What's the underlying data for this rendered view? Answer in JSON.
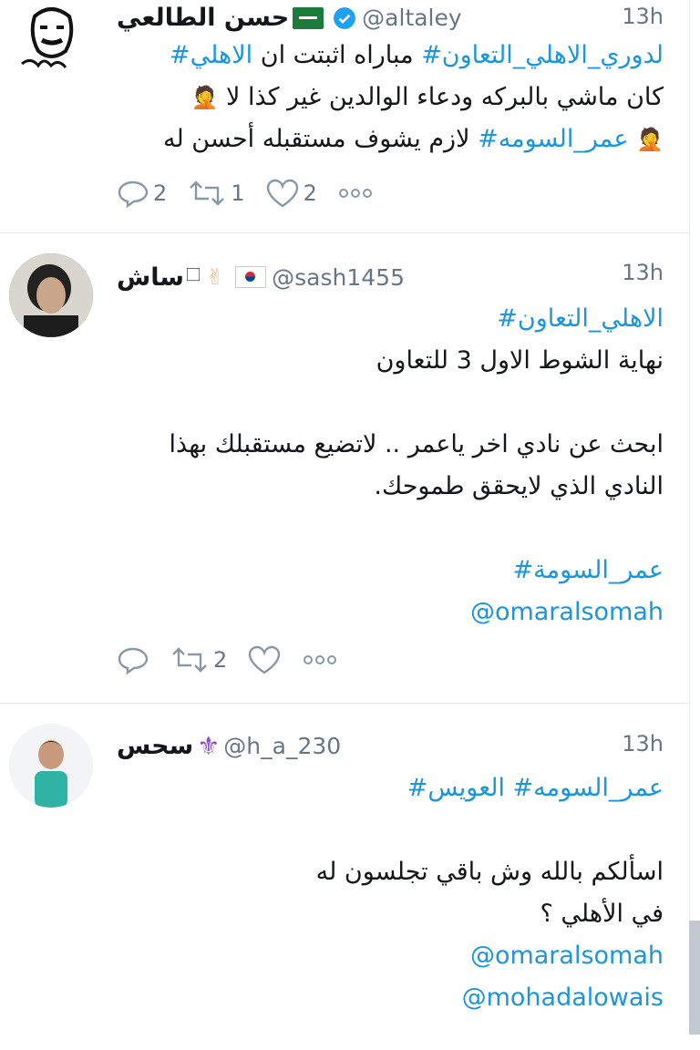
{
  "colors": {
    "link": "#1b95e0",
    "muted": "#657786",
    "text": "#14171a",
    "verified": "#1da1f2"
  },
  "tweets": [
    {
      "name": "حسن الطالعي",
      "handle": "@altaley",
      "time": "13h",
      "verified": true,
      "flag": "saudi-flag",
      "lines": [
        {
          "tag1": "لدوري_الاهلي_التعاون#",
          "text": " مباراه اثبتت ان ",
          "tag2": "الاهلي#"
        },
        {
          "text": "كان ماشي بالبركه ودعاء الوالدين غير كذا لا",
          "emoji": "🤦"
        },
        {
          "emoji": "🤦",
          "tag": " عمر_السومه#",
          "text": " لازم يشوف مستقبله أحسن له"
        }
      ],
      "replies": "2",
      "retweets": "1",
      "likes": "2"
    },
    {
      "name": "ساش",
      "suffix": "🗆",
      "handle": "@sash1455",
      "time": "13h",
      "emoji": "✌",
      "flag": "korea-flag",
      "line1_tag": "الاهلي_التعاون#",
      "line2": "نهاية الشوط الاول 3 للتعاون",
      "line3": "ابحث عن نادي اخر ياعمر .. لاتضيع مستقبلك بهذا",
      "line4": "النادي الذي لايحقق طموحك.",
      "line5_tag": "عمر_السومة#",
      "mention": "@omaralsomah",
      "replies": "",
      "retweets": "2",
      "likes": ""
    },
    {
      "name": "سحس",
      "emoji": "⚜",
      "handle": "@h_a_230",
      "time": "13h",
      "tags": "عمر_السومه# العويس#",
      "line2": "اسألكم بالله وش باقي تجلسون له",
      "line3": "في الأهلي ؟",
      "mention1": "@omaralsomah",
      "mention2": "@mohadalowais"
    }
  ]
}
